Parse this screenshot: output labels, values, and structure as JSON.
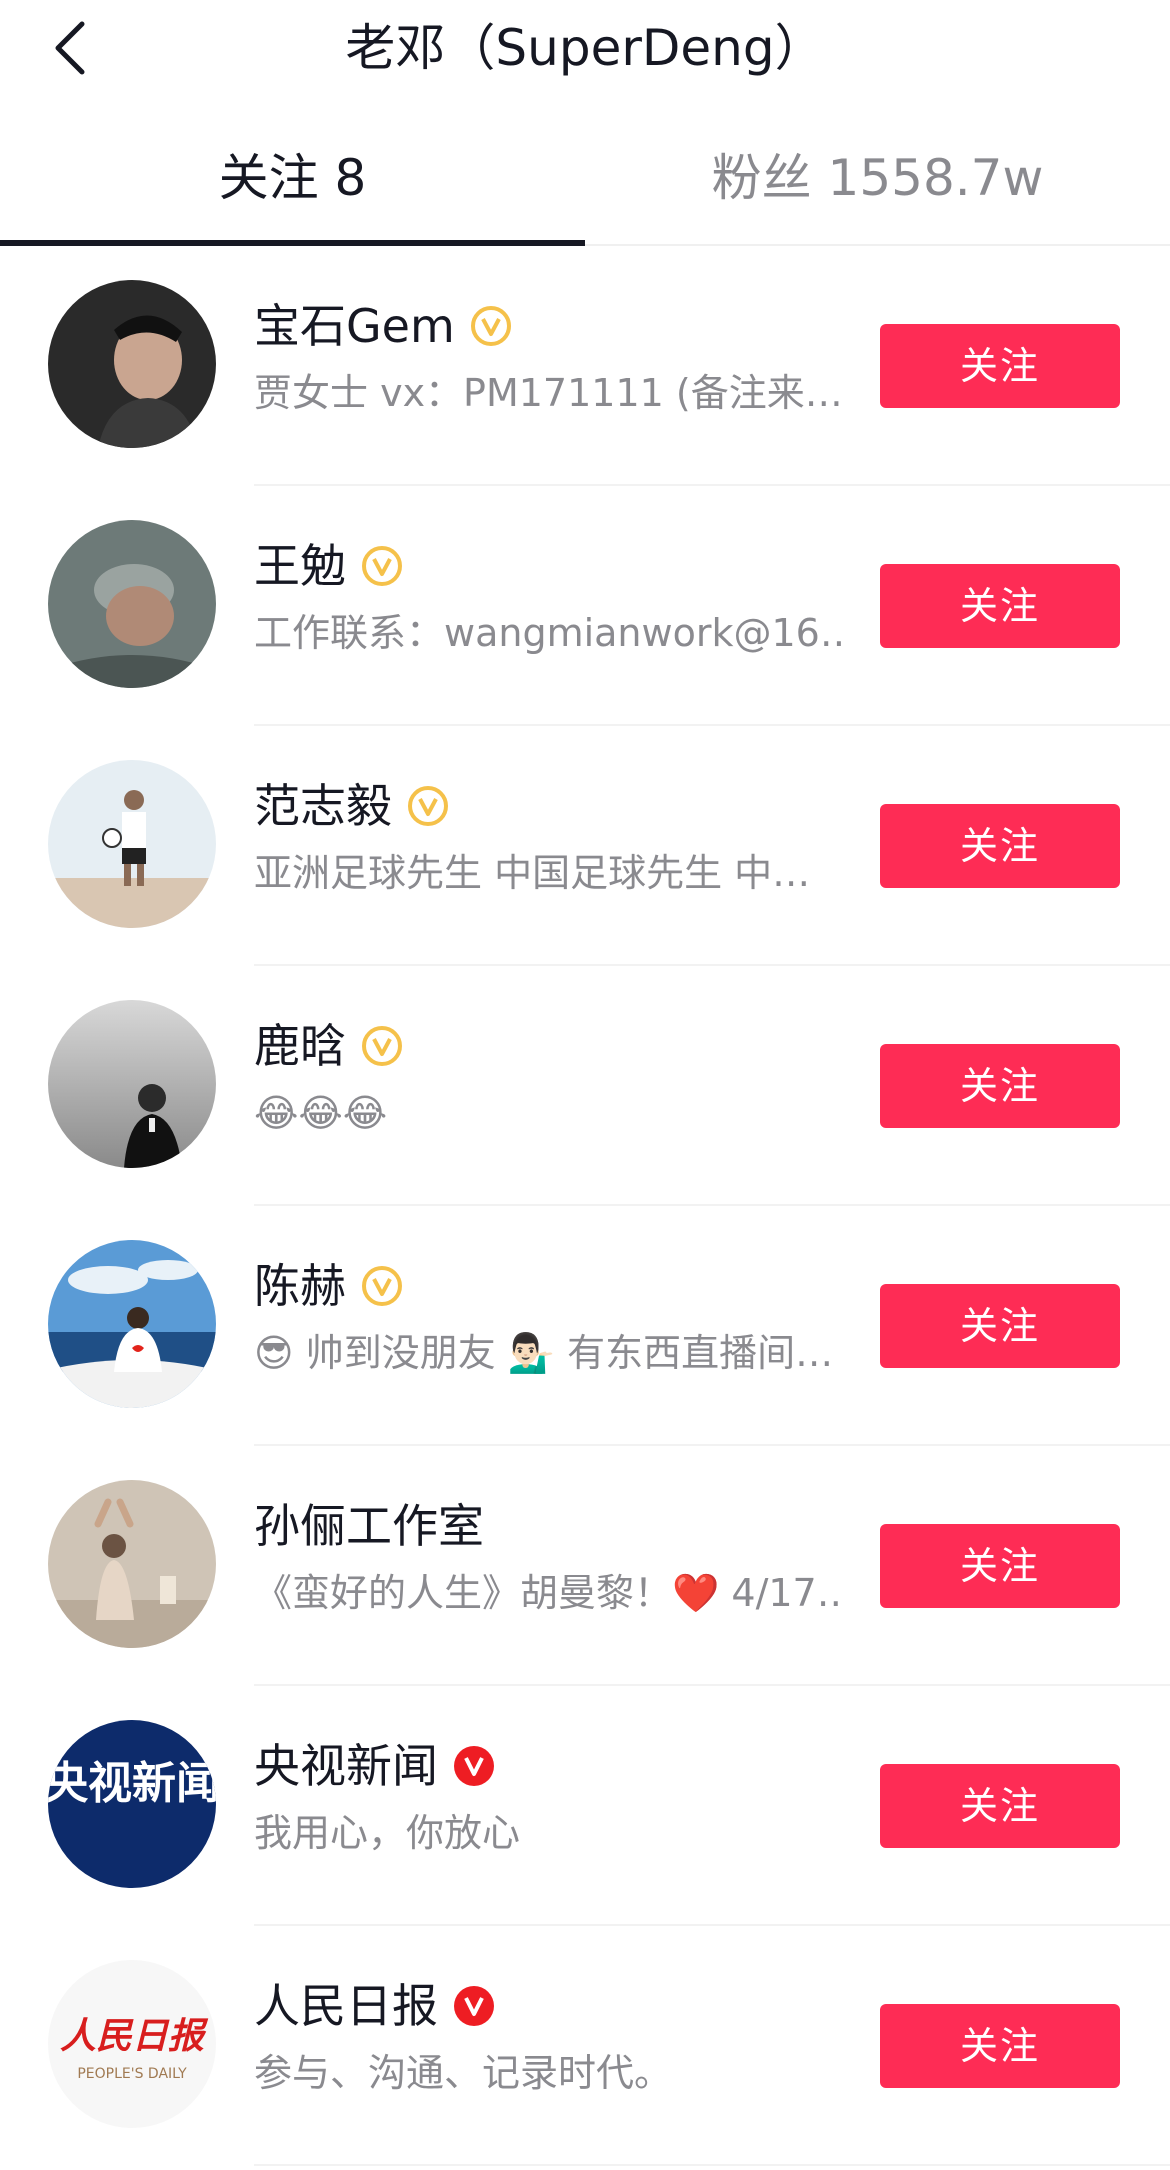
{
  "header": {
    "back_icon": "chevron-left-icon",
    "title": "老邓（SuperDeng）"
  },
  "tabs": [
    {
      "label": "关注 8",
      "active": true
    },
    {
      "label": "粉丝 1558.7w",
      "active": false
    }
  ],
  "colors": {
    "accent": "#fe2c55",
    "gold_badge": "#f5c14a",
    "red_badge": "#ee1d23",
    "text_primary": "#161823",
    "text_secondary": "#8a8a8f"
  },
  "users": [
    {
      "name": "宝石Gem",
      "badge": "gold-verified-icon",
      "bio": "贾女士 vx：PM171111 (备注来…",
      "button": "关注"
    },
    {
      "name": "王勉",
      "badge": "gold-verified-icon",
      "bio": "工作联系：wangmianwork@16…",
      "button": "关注"
    },
    {
      "name": "范志毅",
      "badge": "gold-verified-icon",
      "bio": "亚洲足球先生 中国足球先生 中…",
      "button": "关注"
    },
    {
      "name": "鹿晗",
      "badge": "gold-verified-icon",
      "bio": "😂😂😂",
      "button": "关注"
    },
    {
      "name": "陈赫",
      "badge": "gold-verified-icon",
      "bio": "😎 帅到没朋友 💁🏻‍♂️ 有东西直播间…",
      "button": "关注"
    },
    {
      "name": "孙俪工作室",
      "badge": "",
      "bio": "《蛮好的人生》胡曼黎！❤️ 4/17…",
      "button": "关注"
    },
    {
      "name": "央视新闻",
      "badge": "red-verified-icon",
      "bio": "我用心，你放心",
      "avatar_text": "央视新闻",
      "button": "关注"
    },
    {
      "name": "人民日报",
      "badge": "red-verified-icon",
      "bio": "参与、沟通、记录时代。",
      "avatar_text": "人民日报",
      "avatar_subtext": "PEOPLE'S DAILY",
      "button": "关注"
    }
  ]
}
